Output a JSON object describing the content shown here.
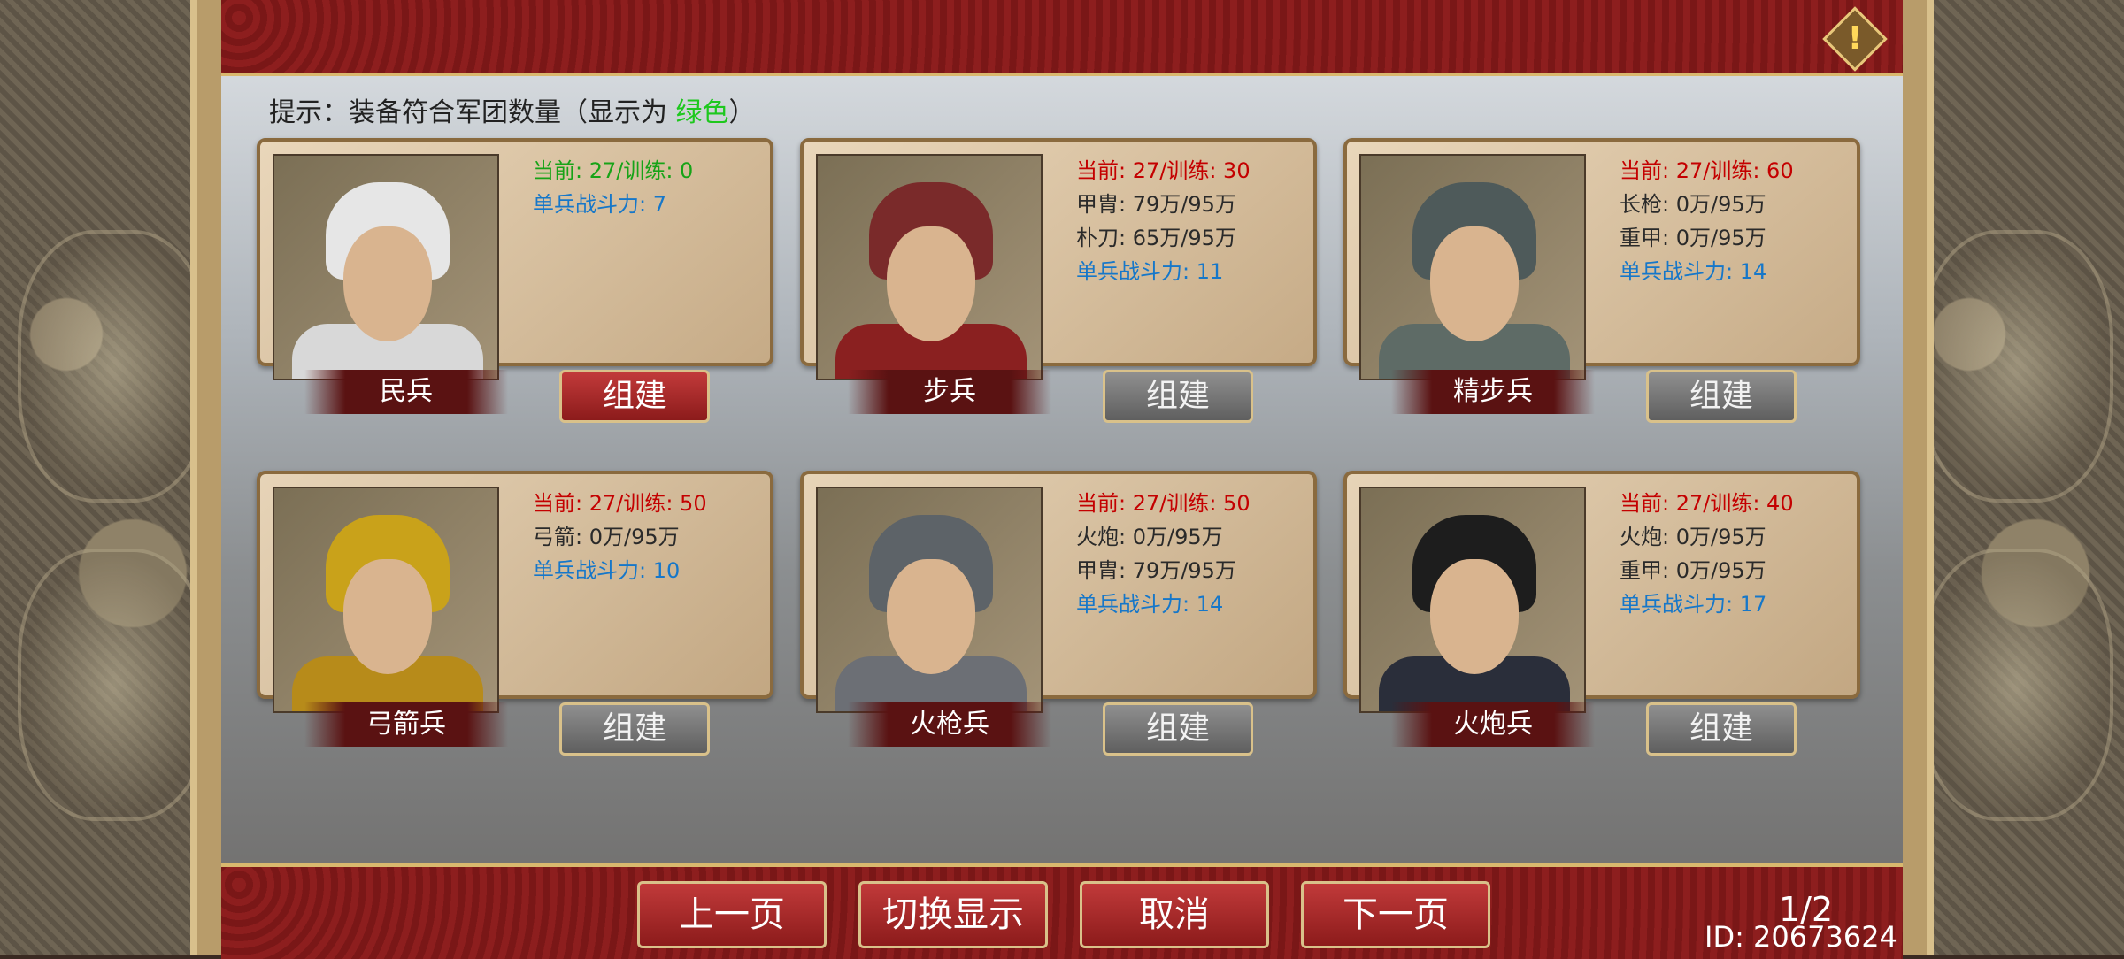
{
  "hint": {
    "prefix": "提示：装备符合军团数量（显示为 ",
    "green_word": "绿色",
    "suffix": "）"
  },
  "icons": {
    "alert": "exclamation-icon"
  },
  "units": [
    {
      "name": "民兵",
      "current": "当前: 27/训练: 0",
      "current_color": "green",
      "lines": [],
      "power": "单兵战斗力: 7",
      "build_label": "组建",
      "build_enabled": true
    },
    {
      "name": "步兵",
      "current": "当前: 27/训练: 30",
      "current_color": "red",
      "lines": [
        "甲胄: 79万/95万",
        "朴刀: 65万/95万"
      ],
      "power": "单兵战斗力: 11",
      "build_label": "组建",
      "build_enabled": false
    },
    {
      "name": "精步兵",
      "current": "当前: 27/训练: 60",
      "current_color": "red",
      "lines": [
        "长枪: 0万/95万",
        "重甲: 0万/95万"
      ],
      "power": "单兵战斗力: 14",
      "build_label": "组建",
      "build_enabled": false
    },
    {
      "name": "弓箭兵",
      "current": "当前: 27/训练: 50",
      "current_color": "red",
      "lines": [
        "弓箭: 0万/95万"
      ],
      "power": "单兵战斗力: 10",
      "build_label": "组建",
      "build_enabled": false
    },
    {
      "name": "火枪兵",
      "current": "当前: 27/训练: 50",
      "current_color": "red",
      "lines": [
        "火炮: 0万/95万",
        "甲胄: 79万/95万"
      ],
      "power": "单兵战斗力: 14",
      "build_label": "组建",
      "build_enabled": false
    },
    {
      "name": "火炮兵",
      "current": "当前: 27/训练: 40",
      "current_color": "red",
      "lines": [
        "火炮: 0万/95万",
        "重甲: 0万/95万"
      ],
      "power": "单兵战斗力: 17",
      "build_label": "组建",
      "build_enabled": false
    }
  ],
  "nav": {
    "prev": "上一页",
    "toggle": "切换显示",
    "cancel": "取消",
    "next": "下一页"
  },
  "page_indicator": "1/2",
  "user_id": "ID: 20673624"
}
